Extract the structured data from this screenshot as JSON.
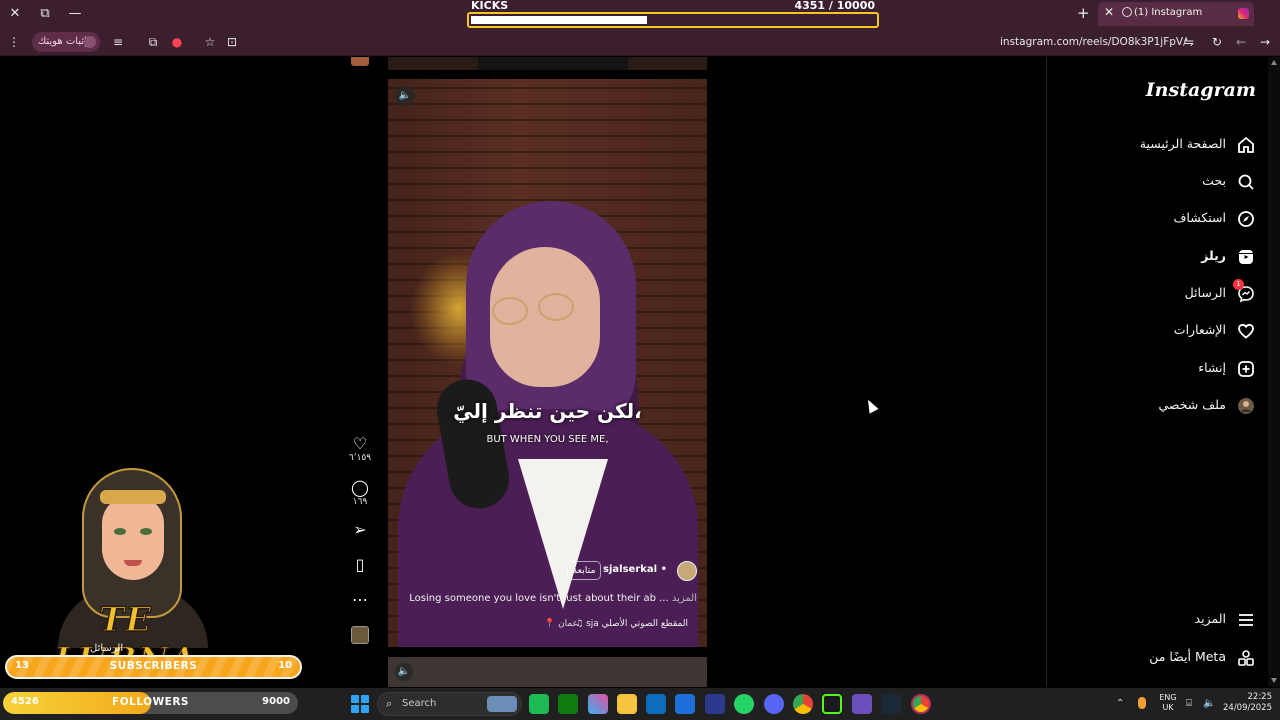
{
  "kicks_widget": {
    "label": "KICKS",
    "count": "4351  / 10000",
    "progress_fraction": 0.4351
  },
  "browser": {
    "tab_title": "(1) Instagram",
    "url": "instagram.com/reels/DO8k3P1jFpV/",
    "extension_chip_label": "إثبات هويتك",
    "window_controls": {
      "close": "✕",
      "restore": "⧉",
      "minimize": "—"
    },
    "new_tab": "+",
    "tab_close": "✕"
  },
  "sidebar": {
    "logo": "Instagram",
    "items": [
      {
        "label": "الصفحة الرئيسية",
        "icon": "home-icon"
      },
      {
        "label": "بحث",
        "icon": "search-icon"
      },
      {
        "label": "استكشاف",
        "icon": "compass-icon"
      },
      {
        "label": "ريلز",
        "icon": "reels-icon"
      },
      {
        "label": "الرسائل",
        "icon": "messenger-icon",
        "badge": "1"
      },
      {
        "label": "الإشعارات",
        "icon": "heart-icon"
      },
      {
        "label": "إنشاء",
        "icon": "plus-square-icon"
      },
      {
        "label": "ملف شخصي",
        "icon": "profile-avatar-icon"
      }
    ],
    "more_label": "المزيد",
    "meta_label": "أيضًا من Meta"
  },
  "reel": {
    "caption_ar": "لكن حين تنظر إليّ،",
    "caption_en": "BUT WHEN YOU SEE ME,",
    "author": "sjalserkal",
    "follow_label": "متابعة",
    "separator": "•",
    "description": "Losing someone you love isn't just about their ab ...",
    "more_label": "المزيد",
    "audio_label": "sja  المقطع الصوتي الأصلي",
    "location": "عمان",
    "mute_icon": "🔈"
  },
  "actions": {
    "likes": "٦٬١٥٩",
    "comments": "١٦٩"
  },
  "overlay": {
    "brand": "TE LUBNA",
    "brand_sub": "الرسائل",
    "subscribers": {
      "label": "SUBSCRIBERS",
      "current": "13",
      "goal": "10"
    },
    "followers": {
      "label": "FOLLOWERS",
      "current": "4526",
      "goal": "9000",
      "progress_fraction": 0.503
    }
  },
  "taskbar": {
    "search_placeholder": "Search",
    "lang_top": "ENG",
    "lang_bottom": "UK",
    "time": "22:25",
    "date": "24/09/2025"
  },
  "colors": {
    "chrome_bg": "#3c1f2f",
    "kicks_border": "#f4c621",
    "notification_badge": "#ff3040",
    "subscribers_bar": "#f7a51c",
    "followers_fill": "#f3a91c"
  }
}
